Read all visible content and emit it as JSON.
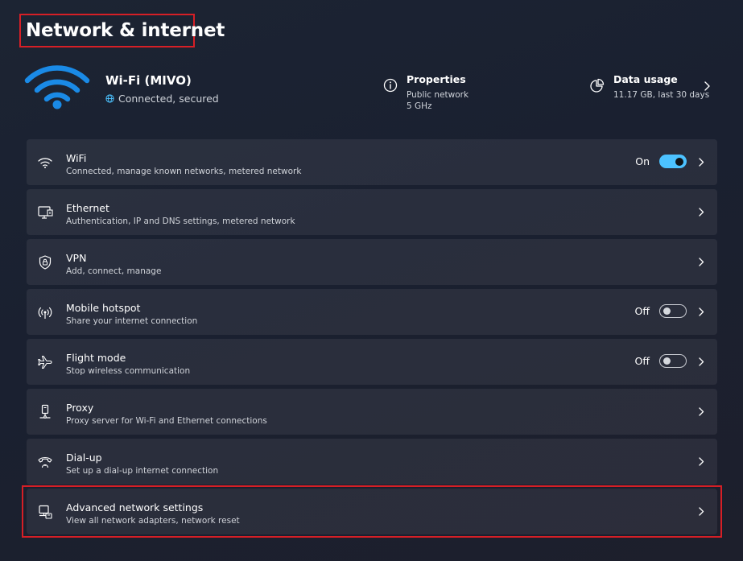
{
  "page": {
    "title": "Network & internet",
    "highlight_color": "#d61f26",
    "accent_color": "#1a8ae6"
  },
  "hero": {
    "icon": "wifi-large-icon",
    "network_name": "Wi-Fi (MIVO)",
    "status": "Connected, secured",
    "properties": {
      "icon": "info-icon",
      "title": "Properties",
      "line1": "Public network",
      "line2": "5 GHz"
    },
    "data_usage": {
      "icon": "pie-chart-icon",
      "title": "Data usage",
      "line1": "11.17 GB, last 30 days"
    }
  },
  "rows": [
    {
      "icon": "wifi-icon",
      "title": "WiFi",
      "subtitle": "Connected, manage known networks, metered network",
      "toggle_label": "On",
      "toggle_state": "on"
    },
    {
      "icon": "ethernet-icon",
      "title": "Ethernet",
      "subtitle": "Authentication, IP and DNS settings, metered network"
    },
    {
      "icon": "vpn-shield-icon",
      "title": "VPN",
      "subtitle": "Add, connect, manage"
    },
    {
      "icon": "hotspot-icon",
      "title": "Mobile hotspot",
      "subtitle": "Share your internet connection",
      "toggle_label": "Off",
      "toggle_state": "off"
    },
    {
      "icon": "airplane-icon",
      "title": "Flight mode",
      "subtitle": "Stop wireless communication",
      "toggle_label": "Off",
      "toggle_state": "off"
    },
    {
      "icon": "proxy-icon",
      "title": "Proxy",
      "subtitle": "Proxy server for Wi-Fi and Ethernet connections"
    },
    {
      "icon": "dial-up-icon",
      "title": "Dial-up",
      "subtitle": "Set up a dial-up internet connection"
    },
    {
      "icon": "advanced-network-icon",
      "title": "Advanced network settings",
      "subtitle": "View all network adapters, network reset",
      "highlighted": true
    }
  ]
}
